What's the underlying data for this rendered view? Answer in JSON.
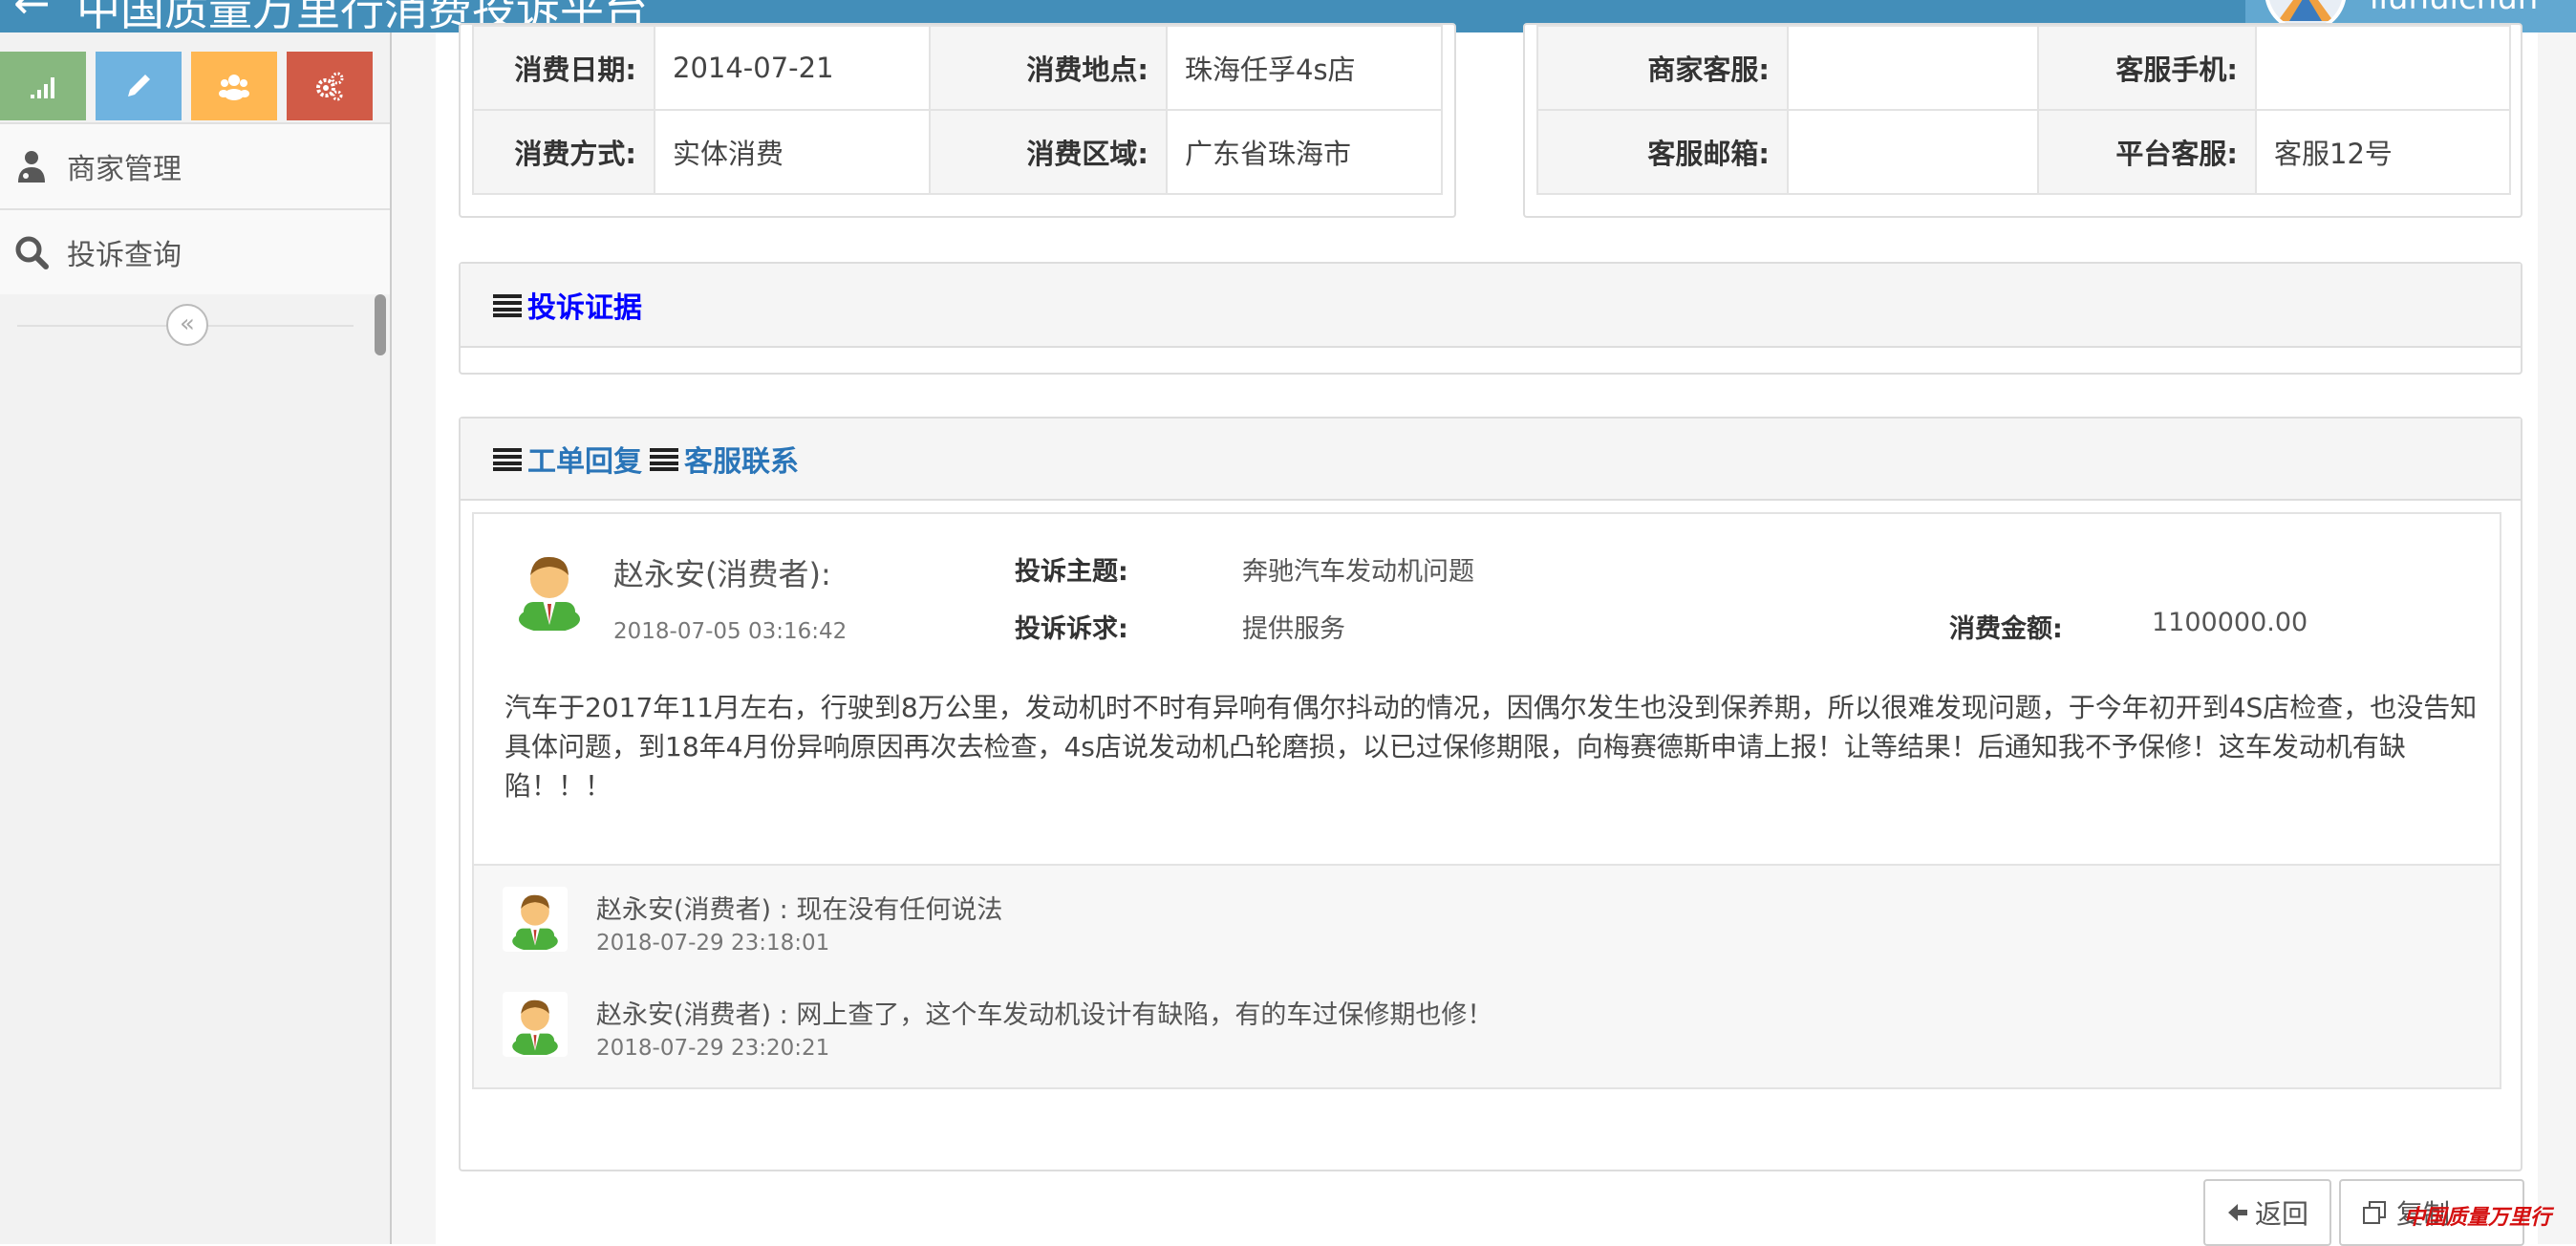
{
  "header": {
    "title": "中国质量万里行消费投诉平台",
    "username": "liuhuichun"
  },
  "sidebar": {
    "shortcuts": [
      {
        "icon": "signal-icon",
        "color": "#87b87f"
      },
      {
        "icon": "pencil-icon",
        "color": "#6fb3e0"
      },
      {
        "icon": "users-icon",
        "color": "#ffb752"
      },
      {
        "icon": "cogs-icon",
        "color": "#d15b47"
      }
    ],
    "items": [
      {
        "label": "商家管理",
        "icon": "user-md-icon"
      },
      {
        "label": "投诉查询",
        "icon": "search-icon"
      }
    ],
    "collapse_symbol": "«"
  },
  "consumption": {
    "date_label": "消费日期:",
    "date_value": "2014-07-21",
    "place_label": "消费地点:",
    "place_value": "珠海任孚4s店",
    "method_label": "消费方式:",
    "method_value": "实体消费",
    "region_label": "消费区域:",
    "region_value": "广东省珠海市"
  },
  "service": {
    "merchant_cs_label": "商家客服:",
    "merchant_cs_value": "",
    "cs_phone_label": "客服手机:",
    "cs_phone_value": "",
    "cs_email_label": "客服邮箱:",
    "cs_email_value": "",
    "platform_cs_label": "平台客服:",
    "platform_cs_value": "客服12号"
  },
  "evidence": {
    "title": "投诉证据"
  },
  "reply_section": {
    "tab1": "工单回复",
    "tab2": "客服联系"
  },
  "complaint": {
    "author": "赵永安(消费者):",
    "date": "2018-07-05 03:16:42",
    "subject_label": "投诉主题:",
    "subject_value": "奔驰汽车发动机问题",
    "demand_label": "投诉诉求:",
    "demand_value": "提供服务",
    "amount_label": "消费金额:",
    "amount_value": "1100000.00",
    "description": "汽车于2017年11月左右，行驶到8万公里，发动机时不时有异响有偶尔抖动的情况，因偶尔发生也没到保养期，所以很难发现问题，于今年初开到4S店检查，也没告知具体问题，到18年4月份异响原因再次去检查，4s店说发动机凸轮磨损，以已过保修期限，向梅赛德斯申请上报！让等结果！后通知我不予保修！这车发动机有缺陷！！！"
  },
  "comments": [
    {
      "text": "赵永安(消费者) : 现在没有任何说法",
      "date": "2018-07-29 23:18:01"
    },
    {
      "text": "赵永安(消费者) : 网上查了，这个车发动机设计有缺陷，有的车过保修期也修！",
      "date": "2018-07-29 23:20:21"
    }
  ],
  "actions": {
    "back_label": "返回",
    "copy_label": "复制"
  },
  "watermark": "中国质量万里行"
}
